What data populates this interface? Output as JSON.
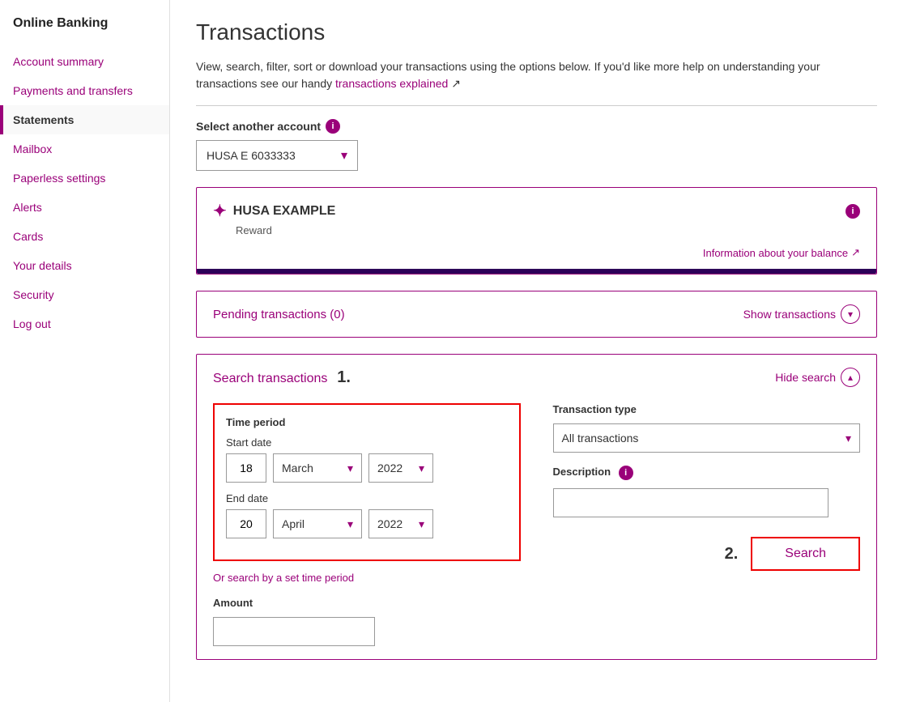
{
  "sidebar": {
    "title": "Online Banking",
    "items": [
      {
        "id": "account-summary",
        "label": "Account summary",
        "active": false
      },
      {
        "id": "payments-transfers",
        "label": "Payments and transfers",
        "active": false
      },
      {
        "id": "statements",
        "label": "Statements",
        "active": true
      },
      {
        "id": "mailbox",
        "label": "Mailbox",
        "active": false
      },
      {
        "id": "paperless-settings",
        "label": "Paperless settings",
        "active": false
      },
      {
        "id": "alerts",
        "label": "Alerts",
        "active": false
      },
      {
        "id": "cards",
        "label": "Cards",
        "active": false
      },
      {
        "id": "your-details",
        "label": "Your details",
        "active": false
      },
      {
        "id": "security",
        "label": "Security",
        "active": false
      },
      {
        "id": "log-out",
        "label": "Log out",
        "active": false
      }
    ]
  },
  "main": {
    "page_title": "Transactions",
    "description_text": "View, search, filter, sort or download your transactions using the options below. If you'd like more help on understanding your transactions see our handy ",
    "description_link": "transactions explained",
    "account_selector": {
      "label": "Select another account",
      "selected": "HUSA E 6033333"
    },
    "account_card": {
      "name": "HUSA EXAMPLE",
      "type": "Reward",
      "balance_link": "Information about your balance"
    },
    "pending": {
      "title": "Pending transactions (0)",
      "button_label": "Show transactions"
    },
    "search_section": {
      "title": "Search transactions",
      "step_indicator": "1.",
      "hide_search_label": "Hide search",
      "time_period_label": "Time period",
      "start_date_label": "Start date",
      "start_day": "18",
      "start_month": "March",
      "start_year": "2022",
      "end_date_label": "End date",
      "end_day": "20",
      "end_month": "April",
      "end_year": "2022",
      "set_time_link": "Or search by a set time period",
      "transaction_type_label": "Transaction type",
      "transaction_type_selected": "All transactions",
      "amount_label": "Amount",
      "description_label": "Description",
      "step2_indicator": "2.",
      "search_button_label": "Search"
    }
  }
}
